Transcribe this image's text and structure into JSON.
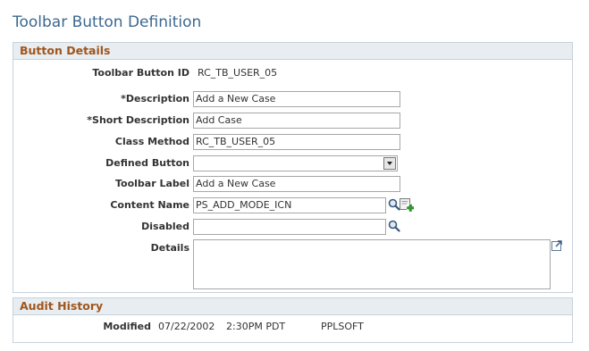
{
  "page": {
    "title": "Toolbar Button Definition"
  },
  "button_details": {
    "header": "Button Details",
    "fields": {
      "toolbar_button_id": {
        "label": "Toolbar Button ID",
        "value": "RC_TB_USER_05"
      },
      "description": {
        "label": "*Description",
        "value": "Add a New Case"
      },
      "short_description": {
        "label": "*Short Description",
        "value": "Add Case"
      },
      "class_method": {
        "label": "Class Method",
        "value": "RC_TB_USER_05"
      },
      "defined_button": {
        "label": "Defined Button",
        "value": ""
      },
      "toolbar_label": {
        "label": "Toolbar Label",
        "value": "Add a New Case"
      },
      "content_name": {
        "label": "Content Name",
        "value": "PS_ADD_MODE_ICN"
      },
      "disabled": {
        "label": "Disabled",
        "value": ""
      },
      "details": {
        "label": "Details",
        "value": ""
      }
    }
  },
  "audit_history": {
    "header": "Audit History",
    "modified_label": "Modified",
    "modified_date": "07/22/2002",
    "modified_time": "2:30PM PDT",
    "modified_by": "PPLSOFT"
  },
  "icons": {
    "lookup": "magnifier-icon",
    "add": "add-icon",
    "expand": "expand-textarea-icon"
  },
  "colors": {
    "title": "#3d6890",
    "section_header_text": "#a0551c",
    "section_header_bg": "#e7edf1",
    "section_border": "#c7d2dc"
  }
}
